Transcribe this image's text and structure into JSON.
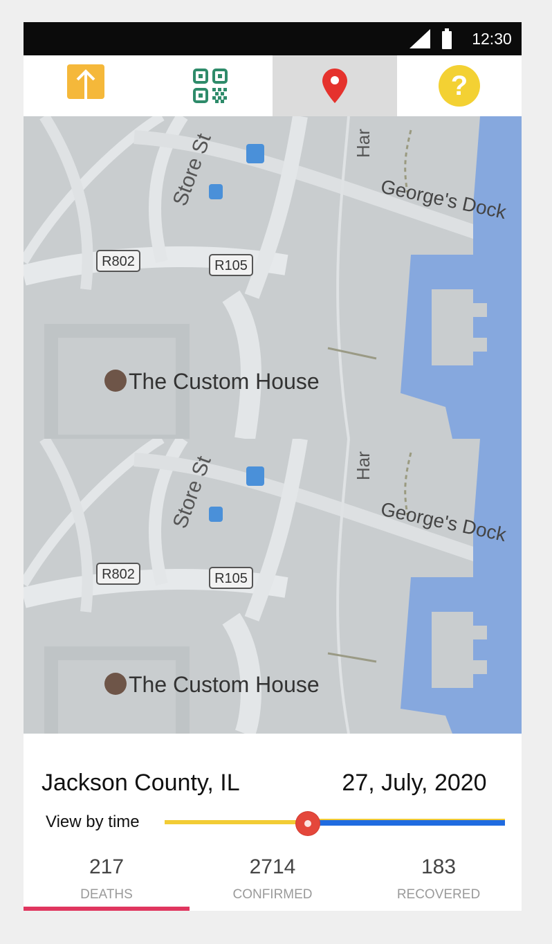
{
  "status_bar": {
    "time": "12:30",
    "signal_icon": "cellular-signal-icon",
    "battery_icon": "battery-icon"
  },
  "tabs": [
    {
      "name": "upload",
      "icon": "upload-arrow-icon",
      "color": "#f5b83a",
      "selected": false
    },
    {
      "name": "qr-code",
      "icon": "qr-code-icon",
      "color": "#2e8b6a",
      "selected": false
    },
    {
      "name": "location",
      "icon": "map-pin-icon",
      "color": "#e5322d",
      "selected": true
    },
    {
      "name": "help",
      "icon": "question-mark-icon",
      "color": "#f3d133",
      "selected": false
    }
  ],
  "map": {
    "street_labels": [
      "Store St",
      "George's Dock",
      "Har"
    ],
    "road_badges": [
      "R802",
      "R105"
    ],
    "poi": "The Custom House"
  },
  "info": {
    "county": "Jackson County, IL",
    "date": "27, July, 2020",
    "view_label": "View by time",
    "slider_fraction": 0.42,
    "stats": [
      {
        "value": "217",
        "label": "DEATHS"
      },
      {
        "value": "2714",
        "label": "CONFIRMED"
      },
      {
        "value": "183",
        "label": "RECOVERED"
      }
    ],
    "selected_stat": 0
  },
  "colors": {
    "slider_left": "#f2cc35",
    "slider_right": "#1f6be0",
    "slider_thumb": "#e4473b",
    "stat_indicator": "#e0365f",
    "water": "#86a8de",
    "land": "#c9cdcf"
  }
}
